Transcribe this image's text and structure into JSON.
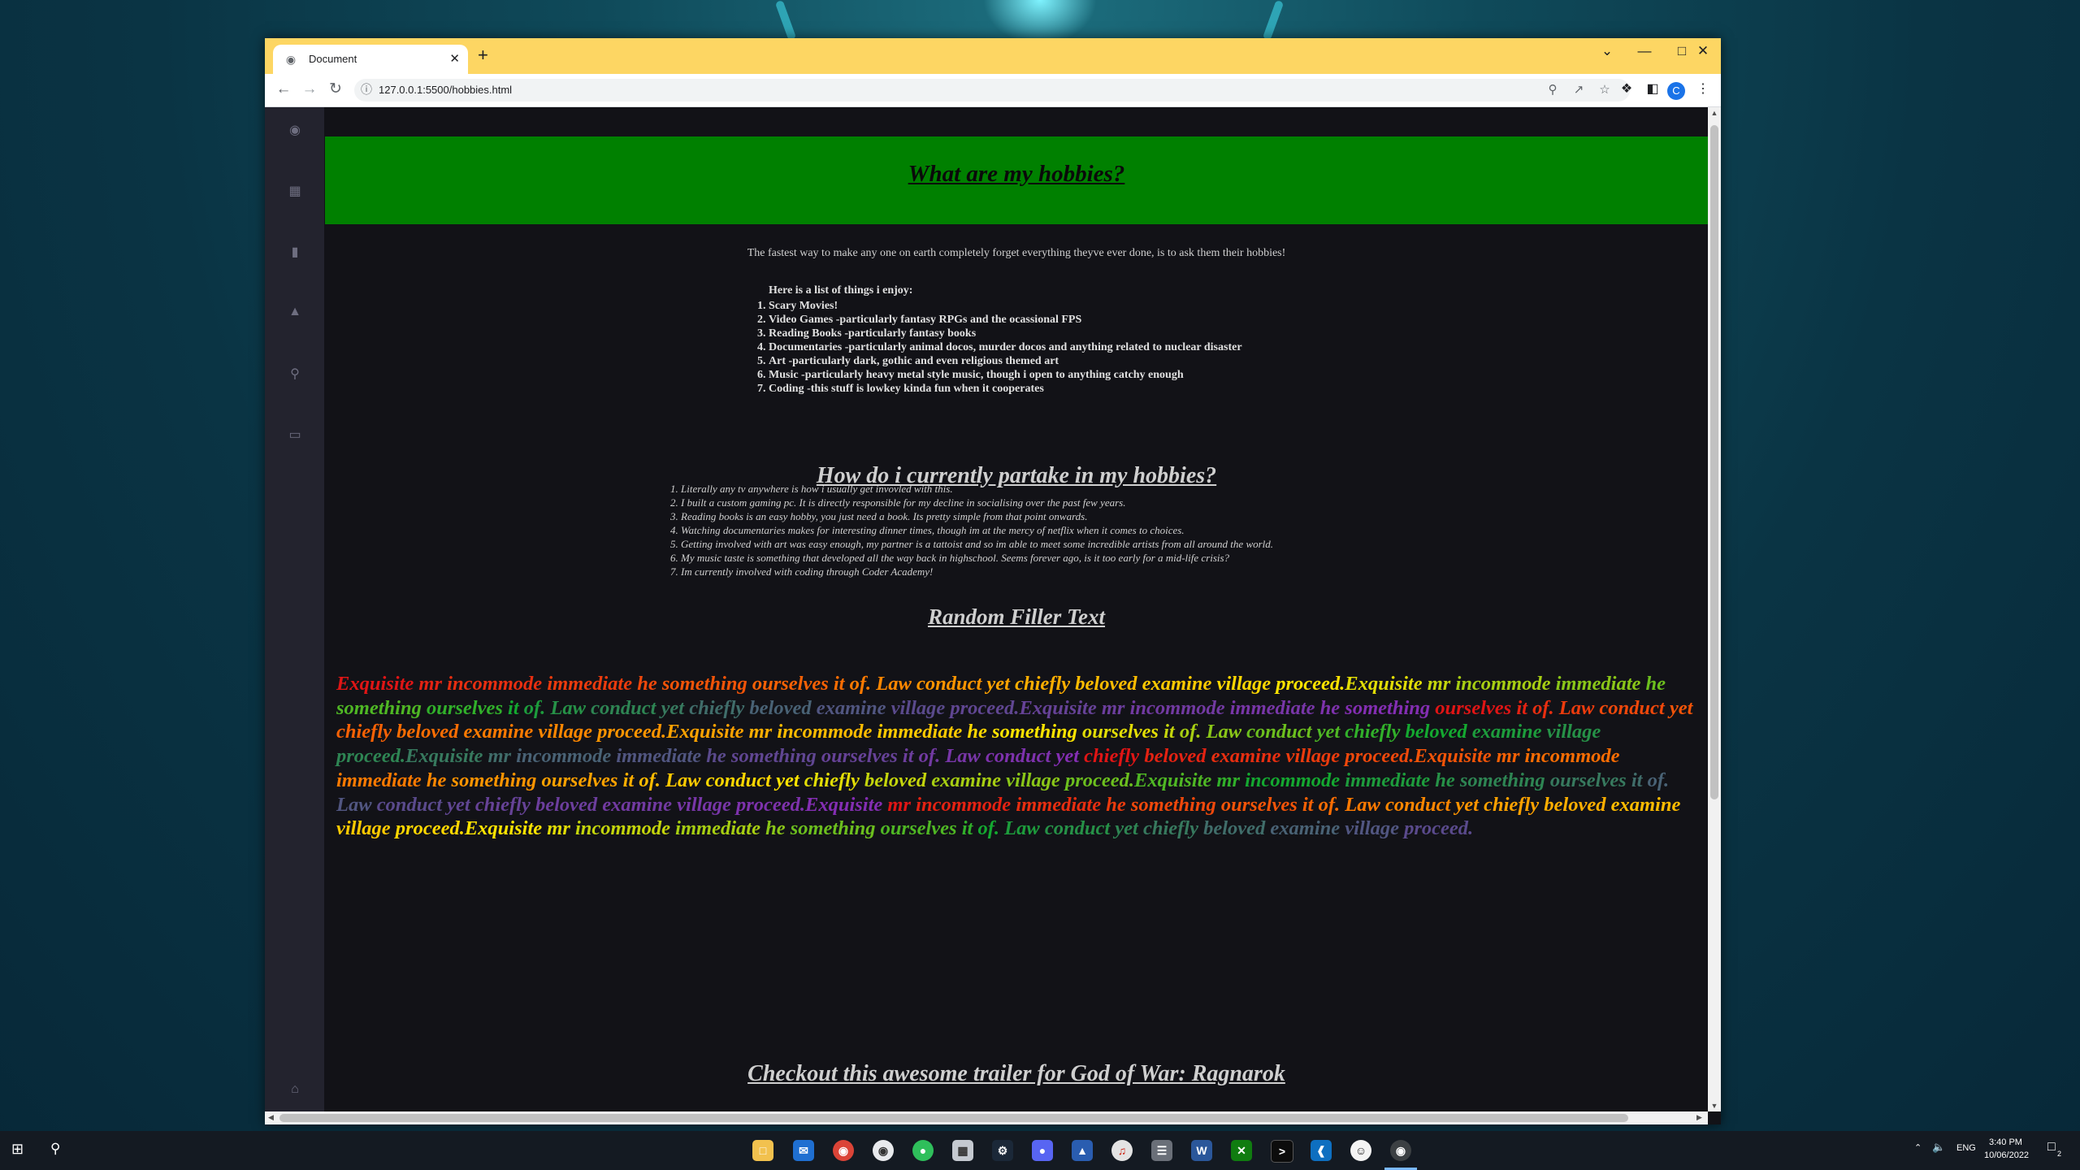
{
  "browser": {
    "tab_title": "Document",
    "new_tab": "+",
    "url": "127.0.0.1:5500/hobbies.html",
    "profile_initial": "C"
  },
  "page": {
    "heading": "What are my hobbies?",
    "tagline": "The fastest way to make any one on earth completely forget everything theyve ever done, is to ask them their hobbies!",
    "enjoy_intro": "Here is a list of things i enjoy:",
    "enjoy_items": [
      "Scary Movies!",
      "Video Games -particularly fantasy RPGs and the ocassional FPS",
      "Reading Books -particularly fantasy books",
      "Documentaries -particularly animal docos, murder docos and anything related to nuclear disaster",
      "Art -particularly dark, gothic and even religious themed art",
      "Music -particularly heavy metal style music, though i open to anything catchy enough",
      "Coding -this stuff is lowkey kinda fun when it cooperates"
    ],
    "partake_heading": "How do i currently partake in my hobbies?",
    "partake_items": [
      "Literally any tv anywhere is how i usually get invovled with this.",
      "I built a custom gaming pc. It is directly responsible for my decline in socialising over the past few years.",
      "Reading books is an easy hobby, you just need a book. Its pretty simple from that point onwards.",
      "Watching documentaries makes for interesting dinner times, though im at the mercy of netflix when it comes to choices.",
      "Getting involved with art was easy enough, my partner is a tattoist and so im able to meet some incredible artists from all around the world.",
      "My music taste is something that developed all the way back in highschool. Seems forever ago, is it too early for a mid-life crisis?",
      "Im currently involved with coding through Coder Academy!"
    ],
    "filler_heading": "Random Filler Text",
    "filler_sentence": "Exquisite mr incommode immediate he something ourselves it of. Law conduct yet chiefly beloved examine village proceed.",
    "filler_repeat": 9,
    "rainbow_colors": [
      "#e01515",
      "#ff7a00",
      "#ffe400",
      "#14a830",
      "#5a4a8c",
      "#8a2ab8"
    ],
    "trailer_heading": "Checkout this awesome trailer for God of War: Ragnarok"
  },
  "sidebar_icons": [
    "github-icon",
    "linkedin-icon",
    "document-icon",
    "bell-icon",
    "search-icon",
    "monitor-icon",
    "home-icon"
  ],
  "taskbar": {
    "language": "ENG",
    "time": "3:40 PM",
    "date": "10/06/2022",
    "notification_count": "2"
  }
}
